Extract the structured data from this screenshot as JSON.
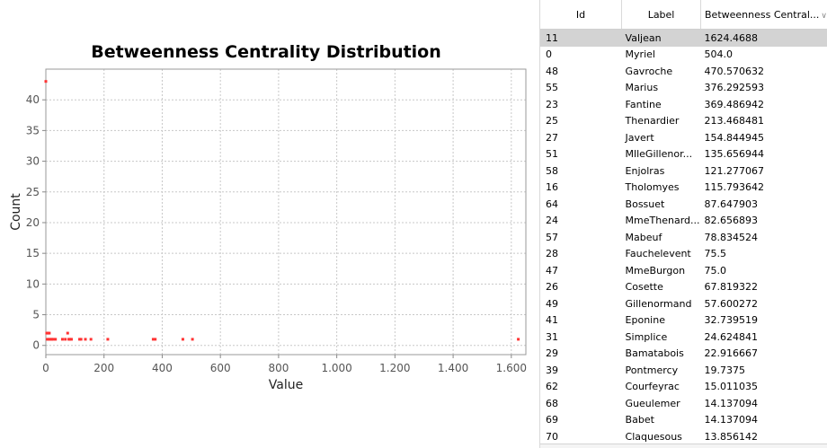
{
  "chart_data": {
    "type": "scatter",
    "title": "Betweenness Centrality Distribution",
    "xlabel": "Value",
    "ylabel": "Count",
    "xlim": [
      0,
      1650
    ],
    "ylim": [
      -1.5,
      45
    ],
    "xticks": [
      0,
      200,
      400,
      600,
      800,
      1000,
      1200,
      1400,
      1600
    ],
    "xtick_labels": [
      "0",
      "200",
      "400",
      "600",
      "800",
      "1.000",
      "1.200",
      "1.400",
      "1.600"
    ],
    "yticks": [
      0,
      5,
      10,
      15,
      20,
      25,
      30,
      35,
      40
    ],
    "grid": true,
    "point_color": "#ff3333",
    "points": [
      [
        0,
        43
      ],
      [
        3,
        2
      ],
      [
        7,
        2
      ],
      [
        12,
        2
      ],
      [
        5,
        1
      ],
      [
        10,
        1
      ],
      [
        15,
        1
      ],
      [
        20,
        1
      ],
      [
        25,
        1
      ],
      [
        33,
        1
      ],
      [
        57,
        1
      ],
      [
        67,
        1
      ],
      [
        75,
        2
      ],
      [
        79,
        1
      ],
      [
        83,
        1
      ],
      [
        88,
        1
      ],
      [
        116,
        1
      ],
      [
        121,
        1
      ],
      [
        136,
        1
      ],
      [
        155,
        1
      ],
      [
        213,
        1
      ],
      [
        369,
        1
      ],
      [
        376,
        1
      ],
      [
        471,
        1
      ],
      [
        504,
        1
      ],
      [
        1624,
        1
      ]
    ]
  },
  "table": {
    "columns": [
      "Id",
      "Label",
      "Betweenness Central..."
    ],
    "sort_icon": "chevron-down-icon",
    "selected_index": 0,
    "rows": [
      [
        "11",
        "Valjean",
        "1624.4688"
      ],
      [
        "0",
        "Myriel",
        "504.0"
      ],
      [
        "48",
        "Gavroche",
        "470.570632"
      ],
      [
        "55",
        "Marius",
        "376.292593"
      ],
      [
        "23",
        "Fantine",
        "369.486942"
      ],
      [
        "25",
        "Thenardier",
        "213.468481"
      ],
      [
        "27",
        "Javert",
        "154.844945"
      ],
      [
        "51",
        "MlleGillenor...",
        "135.656944"
      ],
      [
        "58",
        "Enjolras",
        "121.277067"
      ],
      [
        "16",
        "Tholomyes",
        "115.793642"
      ],
      [
        "64",
        "Bossuet",
        "87.647903"
      ],
      [
        "24",
        "MmeThenard...",
        "82.656893"
      ],
      [
        "57",
        "Mabeuf",
        "78.834524"
      ],
      [
        "28",
        "Fauchelevent",
        "75.5"
      ],
      [
        "47",
        "MmeBurgon",
        "75.0"
      ],
      [
        "26",
        "Cosette",
        "67.819322"
      ],
      [
        "49",
        "Gillenormand",
        "57.600272"
      ],
      [
        "41",
        "Eponine",
        "32.739519"
      ],
      [
        "31",
        "Simplice",
        "24.624841"
      ],
      [
        "29",
        "Bamatabois",
        "22.916667"
      ],
      [
        "39",
        "Pontmercy",
        "19.7375"
      ],
      [
        "62",
        "Courfeyrac",
        "15.011035"
      ],
      [
        "68",
        "Gueulemer",
        "14.137094"
      ],
      [
        "69",
        "Babet",
        "14.137094"
      ],
      [
        "70",
        "Claquesous",
        "13.856142"
      ]
    ]
  }
}
